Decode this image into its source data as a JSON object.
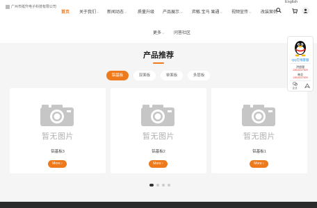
{
  "header": {
    "logo_text": "广州市挺升电子科技有限公司",
    "lang": "English",
    "nav": [
      {
        "label": "首页",
        "active": true,
        "has_dropdown": false
      },
      {
        "label": "关于我们",
        "active": false,
        "has_dropdown": true
      },
      {
        "label": "新闻动态",
        "active": false,
        "has_dropdown": true
      },
      {
        "label": "质量升级",
        "active": false,
        "has_dropdown": false
      },
      {
        "label": "产品展示",
        "active": false,
        "has_dropdown": true
      },
      {
        "label": "弈敏.宝马 果通",
        "active": false,
        "has_dropdown": true
      },
      {
        "label": "视频宣传",
        "active": false,
        "has_dropdown": true
      },
      {
        "label": "改装案例",
        "active": false,
        "has_dropdown": false
      },
      {
        "label": "更多",
        "active": false,
        "has_dropdown": true
      },
      {
        "label": "问答社区",
        "active": false,
        "has_dropdown": false
      }
    ]
  },
  "section": {
    "title": "产品推荐",
    "tabs": [
      {
        "label": "铝基板",
        "active": true
      },
      {
        "label": "双面板",
        "active": false
      },
      {
        "label": "单面板",
        "active": false
      },
      {
        "label": "多层板",
        "active": false
      }
    ]
  },
  "products": [
    {
      "name": "铝基板3",
      "placeholder_text": "暂无图片",
      "button": "More ›"
    },
    {
      "name": "铝基板2",
      "placeholder_text": "暂无图片",
      "button": "More ›"
    },
    {
      "name": "铝基板1",
      "placeholder_text": "暂无图片",
      "button": "More ›"
    }
  ],
  "carousel": {
    "count": 4,
    "active_index": 0
  },
  "float_panel": {
    "title": "QQ在线客服",
    "contacts": [
      {
        "name": "洪经理",
        "phone": "13510227609"
      },
      {
        "name": "林总",
        "phone": "13510227609"
      }
    ],
    "actions": [
      {
        "label": "企业",
        "icon": "wechat-icon"
      },
      {
        "label": "",
        "icon": "back-to-top-icon"
      }
    ]
  },
  "colors": {
    "accent": "#ee7a1c",
    "qq_blue": "#1c8be0",
    "phone_red": "#e0312b",
    "footer": "#2b2b2b"
  }
}
